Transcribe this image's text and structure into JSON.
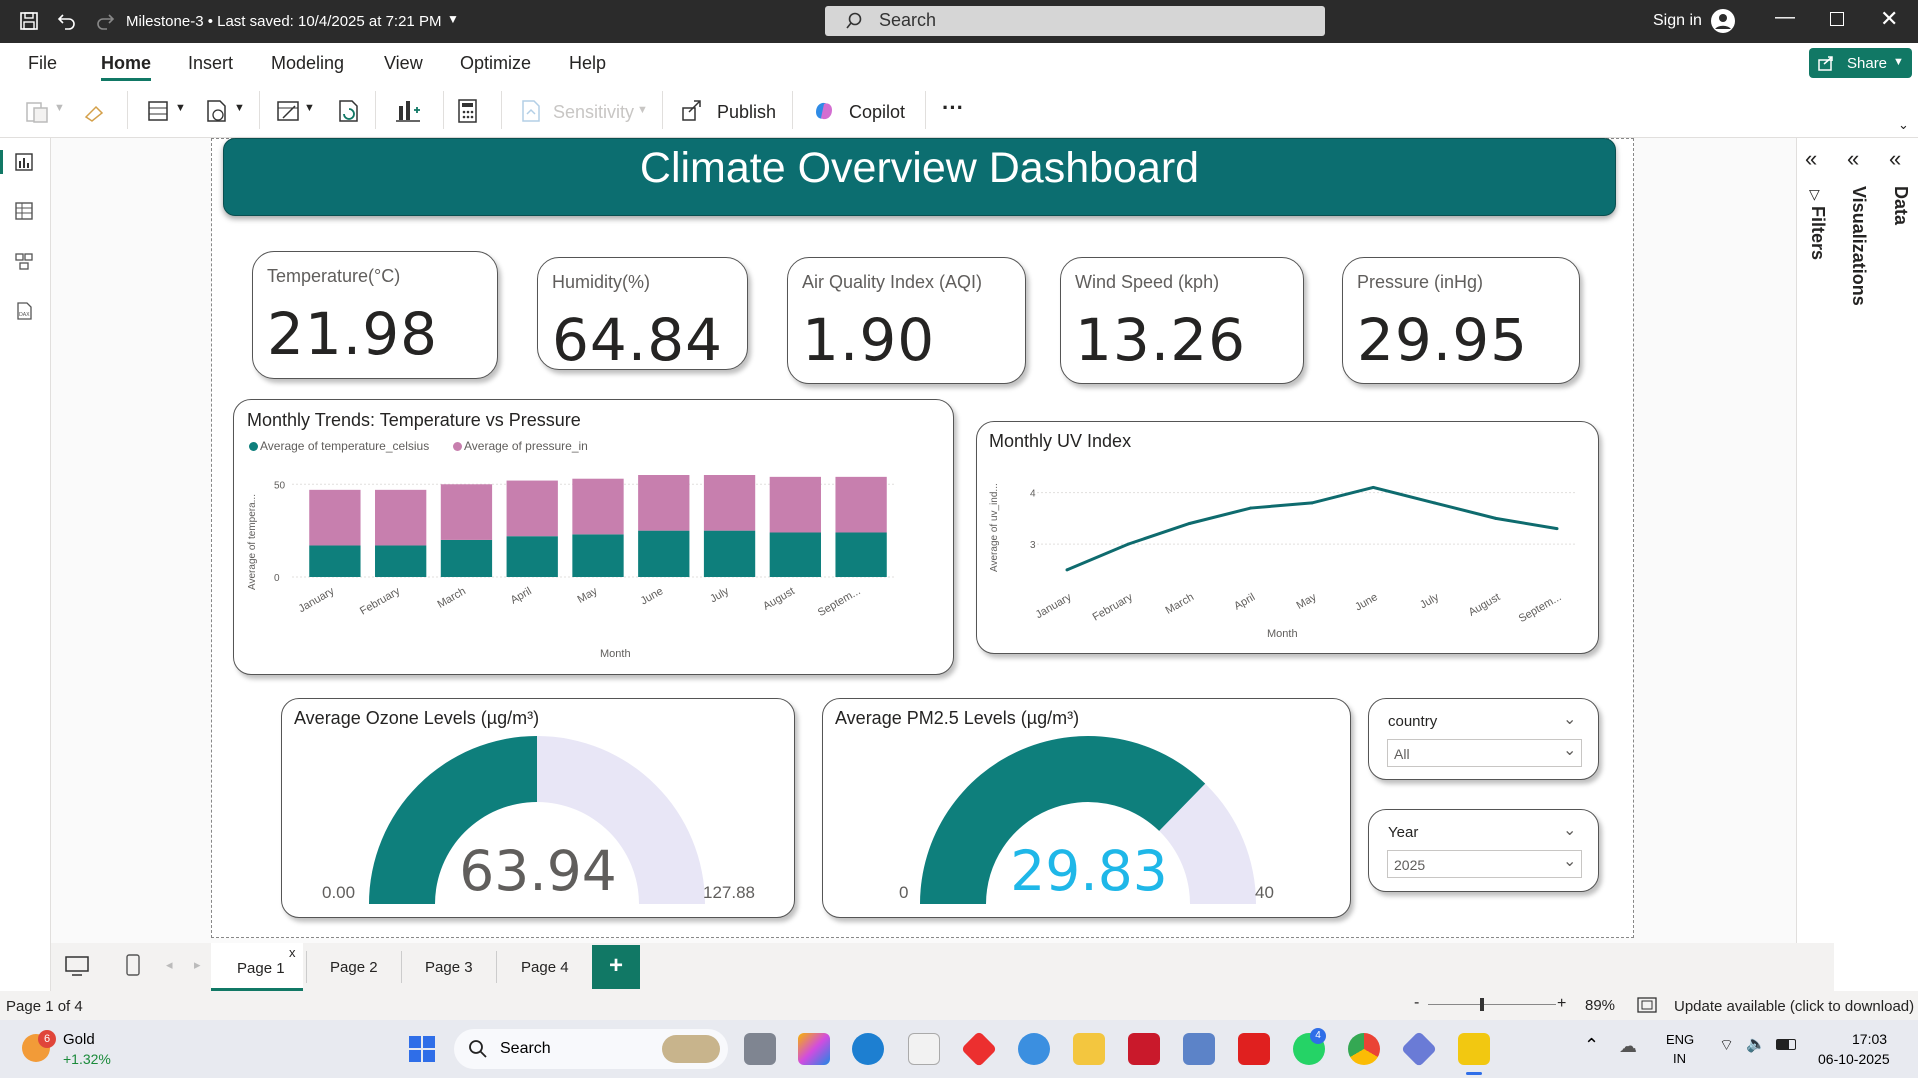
{
  "titlebar": {
    "file_info": "Milestone-3 • Last saved: 10/4/2025 at 7:21 PM",
    "search_placeholder": "Search",
    "signin": "Sign in"
  },
  "menu": {
    "items": [
      "File",
      "Home",
      "Insert",
      "Modeling",
      "View",
      "Optimize",
      "Help"
    ],
    "active": "Home",
    "share": "Share"
  },
  "toolbar": {
    "sensitivity": "Sensitivity",
    "publish": "Publish",
    "copilot": "Copilot",
    "more": "···"
  },
  "dashboard": {
    "title": "Climate Overview Dashboard",
    "kpis": [
      {
        "label": "Temperature(°C)",
        "value": "21.98"
      },
      {
        "label": "Humidity(%)",
        "value": "64.84"
      },
      {
        "label": "Air Quality Index (AQI)",
        "value": "1.90"
      },
      {
        "label": "Wind Speed (kph)",
        "value": "13.26"
      },
      {
        "label": "Pressure (inHg)",
        "value": "29.95"
      }
    ],
    "bar_title": "Monthly Trends: Temperature vs Pressure",
    "bar_legend": [
      "Average of temperature_celsius",
      "Average of pressure_in"
    ],
    "bar_ylabel": "Average of tempera...",
    "bar_xlabel": "Month",
    "line_title": "Monthly UV Index",
    "line_ylabel": "Average of uv_ind...",
    "line_xlabel": "Month",
    "gauge1": {
      "title": "Average Ozone Levels (µg/m³)",
      "value": "63.94",
      "min": "0.00",
      "max": "127.88"
    },
    "gauge2": {
      "title": "Average PM2.5 Levels (µg/m³)",
      "value": "29.83",
      "min": "0",
      "max": "40"
    },
    "slicer1": {
      "title": "country",
      "value": "All"
    },
    "slicer2": {
      "title": "Year",
      "value": "2025"
    }
  },
  "chart_data": [
    {
      "type": "bar",
      "stacked": true,
      "title": "Monthly Trends: Temperature vs Pressure",
      "categories": [
        "January",
        "February",
        "March",
        "April",
        "May",
        "June",
        "July",
        "August",
        "Septem..."
      ],
      "series": [
        {
          "name": "Average of temperature_celsius",
          "color": "#0e7f7c",
          "values": [
            17,
            17,
            20,
            22,
            23,
            25,
            25,
            24,
            24
          ]
        },
        {
          "name": "Average of pressure_in",
          "color": "#c77fae",
          "values": [
            30,
            30,
            30,
            30,
            30,
            30,
            30,
            30,
            30
          ]
        }
      ],
      "yticks": [
        0,
        50
      ],
      "ylim": [
        0,
        55
      ],
      "xlabel": "Month",
      "ylabel": "Average of tempera..."
    },
    {
      "type": "line",
      "title": "Monthly UV Index",
      "categories": [
        "January",
        "February",
        "March",
        "April",
        "May",
        "June",
        "July",
        "August",
        "Septem..."
      ],
      "series": [
        {
          "name": "",
          "color": "#0e6b6e",
          "values": [
            2.5,
            3.0,
            3.4,
            3.7,
            3.8,
            4.1,
            3.8,
            3.5,
            3.3
          ]
        }
      ],
      "yticks": [
        3,
        4
      ],
      "ylim": [
        2.4,
        4.4
      ],
      "xlabel": "Month",
      "ylabel": "Average of uv_ind..."
    },
    {
      "type": "gauge",
      "title": "Average Ozone Levels (µg/m³)",
      "value": 63.94,
      "min": 0,
      "max": 127.88,
      "fill": "#0e7f7c",
      "track": "#e8e6f6"
    },
    {
      "type": "gauge",
      "title": "Average PM2.5 Levels (µg/m³)",
      "value": 29.83,
      "min": 0,
      "max": 40,
      "fill": "#0e7f7c",
      "track": "#e8e6f6"
    }
  ],
  "tabs": {
    "pages": [
      "Page 1",
      "Page 2",
      "Page 3",
      "Page 4"
    ],
    "active": "Page 1",
    "close": "x",
    "add": "+"
  },
  "status": {
    "page": "Page 1 of 4",
    "zoom": "89%",
    "update": "Update available (click to download)"
  },
  "taskbar": {
    "stock_name": "Gold",
    "stock_change": "+1.32%",
    "badge": "6",
    "search": "Search",
    "lang1": "ENG",
    "lang2": "IN",
    "time": "17:03",
    "date": "06-10-2025",
    "whatsapp_badge": "4"
  },
  "panes": {
    "filters": "Filters",
    "visualizations": "Visualizations",
    "data": "Data"
  }
}
